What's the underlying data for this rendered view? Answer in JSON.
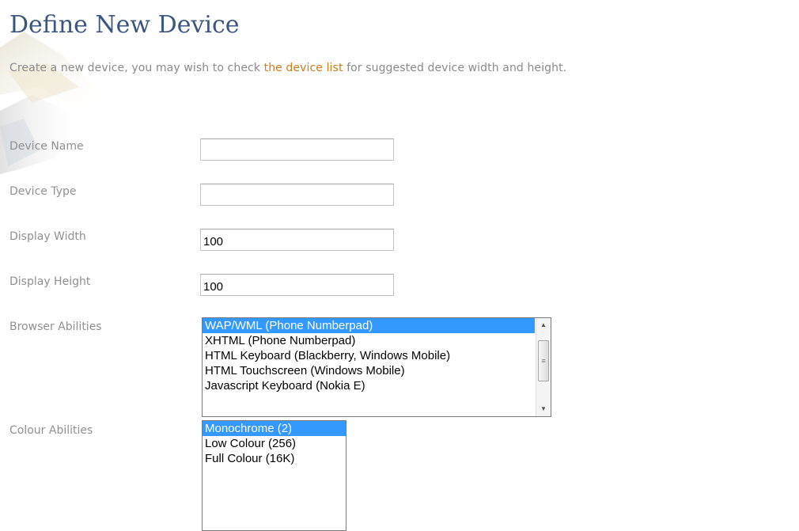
{
  "page": {
    "title": "Define New Device",
    "intro_before": "Create a new device, you may wish to check ",
    "intro_link": "the device list",
    "intro_after": " for suggested device width and height."
  },
  "form": {
    "device_name": {
      "label": "Device Name",
      "value": ""
    },
    "device_type": {
      "label": "Device Type",
      "value": ""
    },
    "display_width": {
      "label": "Display Width",
      "value": "100"
    },
    "display_height": {
      "label": "Display Height",
      "value": "100"
    },
    "browser_abilities": {
      "label": "Browser Abilities",
      "options": [
        "WAP/WML (Phone Numberpad)",
        "XHTML (Phone Numberpad)",
        "HTML Keyboard (Blackberry, Windows Mobile)",
        "HTML Touchscreen (Windows Mobile)",
        "Javascript Keyboard (Nokia E)"
      ],
      "selected": "WAP/WML (Phone Numberpad)"
    },
    "colour_abilities": {
      "label": "Colour Abilities",
      "options": [
        "Monochrome (2)",
        "Low Colour (256)",
        "Full Colour (16K)"
      ],
      "selected": "Monochrome (2)"
    }
  },
  "icons": {
    "scroll_up": "scroll-up-icon",
    "scroll_down": "scroll-down-icon",
    "scroll_grip": "scroll-grip-icon"
  },
  "colors": {
    "title": "#3a5580",
    "link": "#d47a1c",
    "label": "#909090",
    "selection": "#3399ff"
  }
}
